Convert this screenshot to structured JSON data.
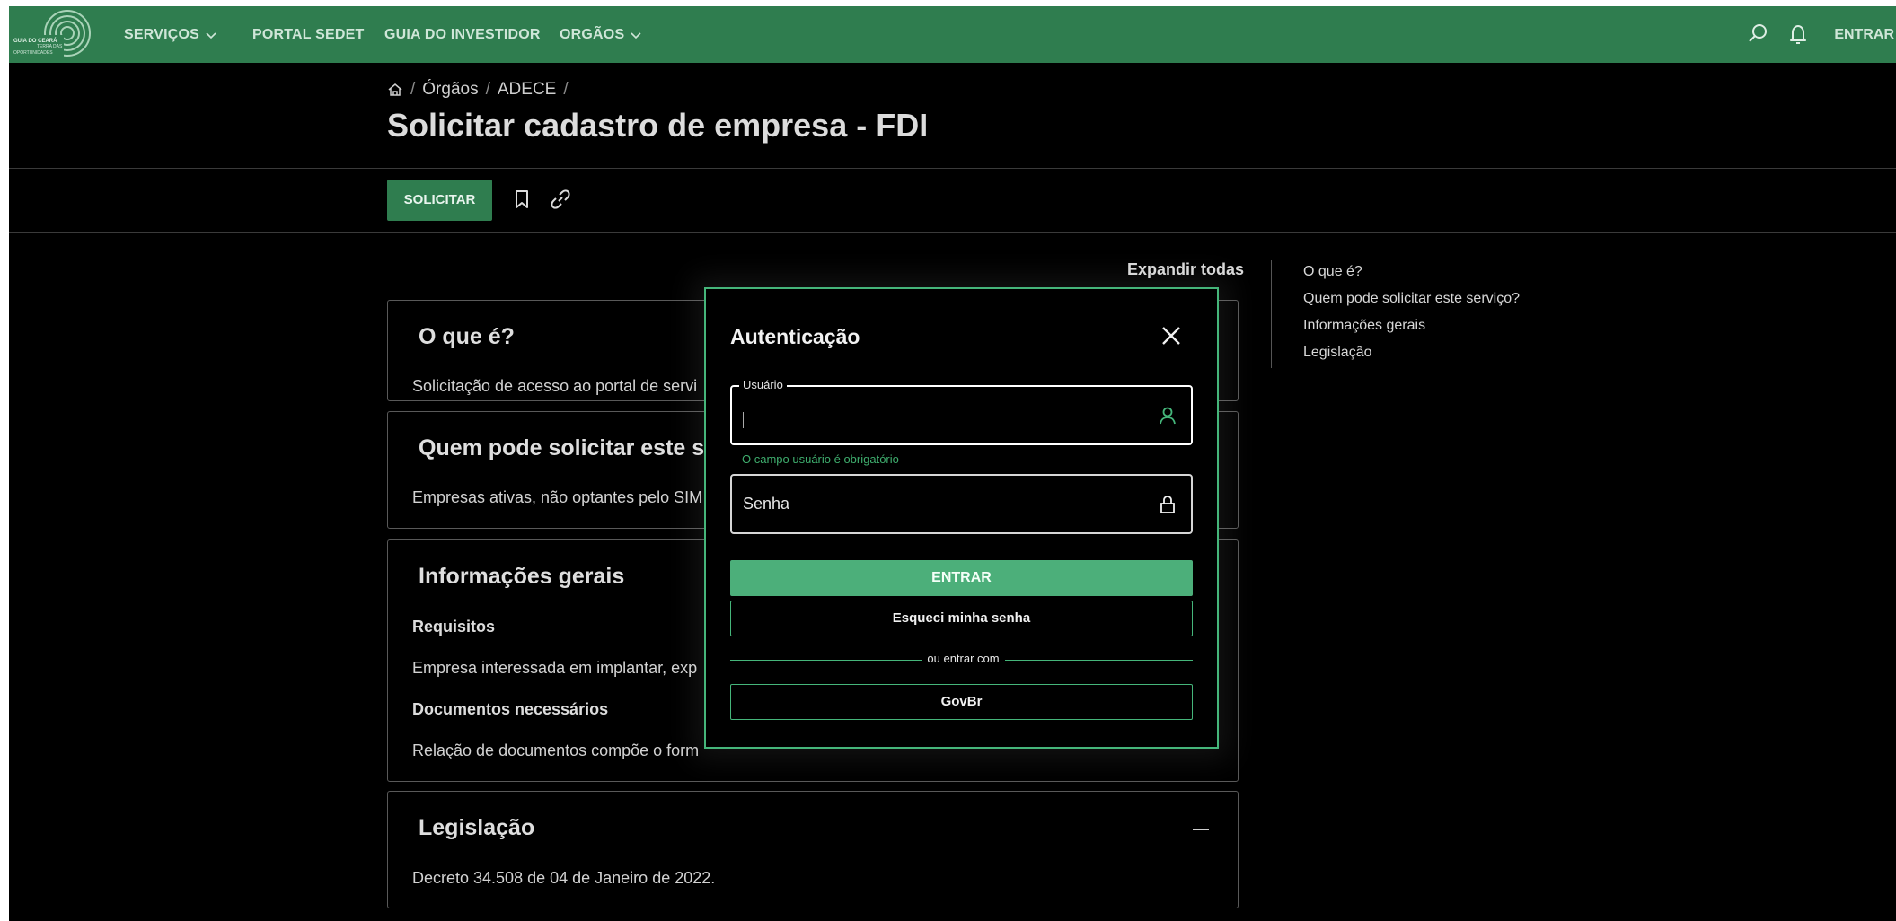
{
  "header": {
    "logo_text": "GUIA DO CEARÁ TERRA DAS OPORTUNIDADES",
    "nav": [
      {
        "label": "SERVIÇOS",
        "has_dropdown": true
      },
      {
        "label": "PORTAL SEDET",
        "has_dropdown": false
      },
      {
        "label": "GUIA DO INVESTIDOR",
        "has_dropdown": false
      },
      {
        "label": "ORGÃOS",
        "has_dropdown": true
      }
    ],
    "entrar_label": "ENTRAR",
    "icons": [
      "search-icon",
      "bell-icon"
    ]
  },
  "breadcrumb": {
    "home_icon": "home-icon",
    "items": [
      "Órgãos",
      "ADECE"
    ],
    "separator": "/"
  },
  "page_title": "Solicitar cadastro de empresa - FDI",
  "toolbar": {
    "solicitar_label": "SOLICITAR",
    "icons": [
      "bookmark-icon",
      "link-icon"
    ]
  },
  "expand_all_label": "Expandir todas",
  "sections": {
    "o_que_e": {
      "title": "O que é?",
      "text": "Solicitação de acesso ao portal de servi"
    },
    "quem_pode": {
      "title": "Quem pode solicitar este se",
      "text": "Empresas ativas, não optantes pelo SIM"
    },
    "info": {
      "title": "Informações gerais",
      "req_label": "Requisitos",
      "req_text": "Empresa interessada em implantar, exp",
      "docs_label": "Documentos necessários",
      "docs_text": "Relação de documentos compõe o form"
    },
    "legislacao": {
      "title": "Legislação",
      "text": "Decreto 34.508 de 04 de Janeiro de 2022."
    }
  },
  "side_nav": [
    "O que é?",
    "Quem pode solicitar este serviço?",
    "Informações gerais",
    "Legislação"
  ],
  "modal": {
    "title": "Autenticação",
    "usuario_label": "Usuário",
    "usuario_value": "",
    "usuario_error": "O campo usuário é obrigatório",
    "senha_placeholder": "Senha",
    "entrar_label": "ENTRAR",
    "esqueci_label": "Esqueci minha senha",
    "or_label": "ou entrar com",
    "govbr_label": "GovBr"
  },
  "colors": {
    "brand_green": "#2f7d4f",
    "accent_green": "#4caf7a",
    "background": "#000000"
  }
}
